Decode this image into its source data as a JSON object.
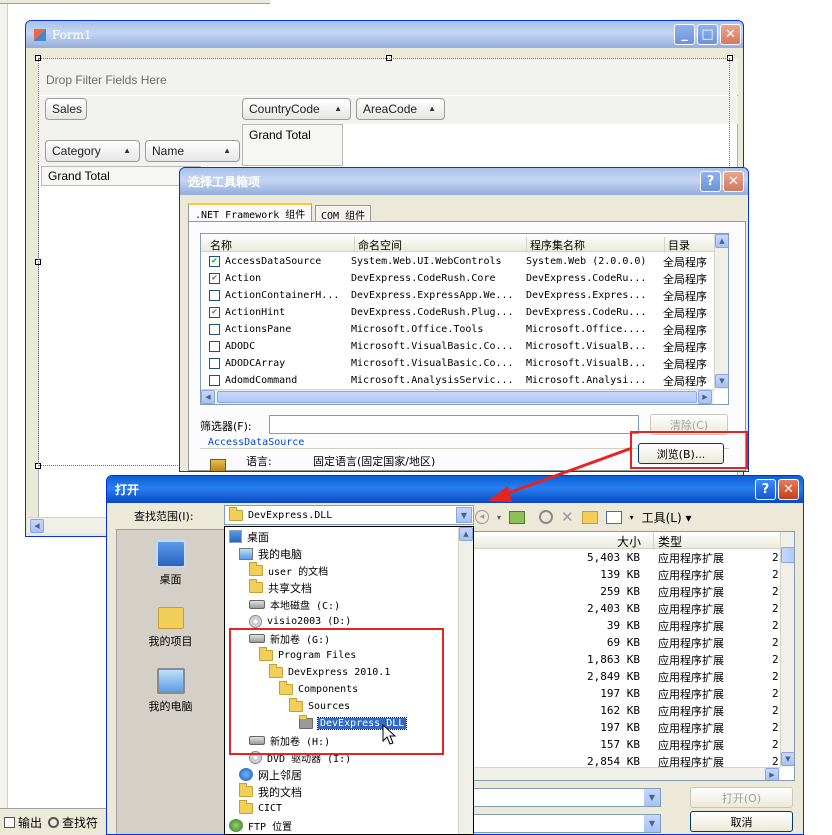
{
  "form1": {
    "title": "Form1",
    "drop_filter": "Drop Filter Fields Here",
    "fields": {
      "sales": "Sales",
      "countrycode": "CountryCode",
      "areacode": "AreaCode",
      "category": "Category",
      "name": "Name"
    },
    "grand_total_col": "Grand Total",
    "grand_total_row": "Grand Total"
  },
  "choose_dialog": {
    "title": "选择工具箱项",
    "tabs": [
      ".NET Framework 组件",
      "COM 组件"
    ],
    "columns": [
      "名称",
      "命名空间",
      "程序集名称",
      "目录"
    ],
    "rows": [
      {
        "checked": true,
        "name": "AccessDataSource",
        "ns": "System.Web.UI.WebControls",
        "asm": "System.Web (2.0.0.0)",
        "dir": "全局程序"
      },
      {
        "checked": true,
        "name": "Action",
        "ns": "DevExpress.CodeRush.Core",
        "asm": "DevExpress.CodeRu...",
        "dir": "全局程序"
      },
      {
        "checked": false,
        "name": "ActionContainerH...",
        "ns": "DevExpress.ExpressApp.We...",
        "asm": "DevExpress.Expres...",
        "dir": "全局程序"
      },
      {
        "checked": true,
        "name": "ActionHint",
        "ns": "DevExpress.CodeRush.Plug...",
        "asm": "DevExpress.CodeRu...",
        "dir": "全局程序"
      },
      {
        "checked": false,
        "name": "ActionsPane",
        "ns": "Microsoft.Office.Tools",
        "asm": "Microsoft.Office....",
        "dir": "全局程序"
      },
      {
        "checked": false,
        "name": "ADODC",
        "ns": "Microsoft.VisualBasic.Co...",
        "asm": "Microsoft.VisualB...",
        "dir": "全局程序"
      },
      {
        "checked": false,
        "name": "ADODCArray",
        "ns": "Microsoft.VisualBasic.Co...",
        "asm": "Microsoft.VisualB...",
        "dir": "全局程序"
      },
      {
        "checked": false,
        "name": "AdomdCommand",
        "ns": "Microsoft.AnalysisServic...",
        "asm": "Microsoft.Analysi...",
        "dir": "全局程序"
      }
    ],
    "filter_label": "筛选器(F):",
    "filter_value": "",
    "clear_button": "清除(C)",
    "selected_component": "AccessDataSource",
    "language_label": "语言:",
    "language_value": "固定语言(固定国家/地区)",
    "browse_button": "浏览(B)..."
  },
  "open_dialog": {
    "title": "打开",
    "lookin_label": "查找范围(I):",
    "lookin_value": "DevExpress.DLL",
    "tools_label": "工具(L)",
    "places": [
      {
        "label": "桌面",
        "icon": "desktop-icon"
      },
      {
        "label": "我的项目",
        "icon": "folder-icon"
      },
      {
        "label": "我的电脑",
        "icon": "computer-icon"
      }
    ],
    "tree": [
      {
        "label": "桌面",
        "type": "desktop",
        "indent": 0
      },
      {
        "label": "我的电脑",
        "type": "computer",
        "indent": 1
      },
      {
        "label": "user 的文档",
        "type": "folder",
        "indent": 2
      },
      {
        "label": "共享文档",
        "type": "folder",
        "indent": 2
      },
      {
        "label": "本地磁盘 (C:)",
        "type": "drive",
        "indent": 2
      },
      {
        "label": "visio2003 (D:)",
        "type": "cd",
        "indent": 2
      },
      {
        "label": "新加卷 (G:)",
        "type": "drive",
        "indent": 2
      },
      {
        "label": "Program Files",
        "type": "folder",
        "indent": 3
      },
      {
        "label": "DevExpress 2010.1",
        "type": "folder",
        "indent": 4
      },
      {
        "label": "Components",
        "type": "folder",
        "indent": 5
      },
      {
        "label": "Sources",
        "type": "folder",
        "indent": 6
      },
      {
        "label": "DevExpress.DLL",
        "type": "folder",
        "indent": 7,
        "selected": true
      },
      {
        "label": "新加卷 (H:)",
        "type": "drive",
        "indent": 2
      },
      {
        "label": "DVD 驱动器 (I:)",
        "type": "cd",
        "indent": 2
      },
      {
        "label": "网上邻居",
        "type": "network",
        "indent": 1
      },
      {
        "label": "我的文档",
        "type": "folder",
        "indent": 1
      },
      {
        "label": "CICT",
        "type": "folder",
        "indent": 1
      },
      {
        "label": "FTP 位置",
        "type": "ftp",
        "indent": 0
      }
    ],
    "columns": [
      "大小",
      "类型"
    ],
    "files": [
      {
        "size": "5,403 KB",
        "type": "应用程序扩展",
        "extra": "2"
      },
      {
        "size": "139 KB",
        "type": "应用程序扩展",
        "extra": "2"
      },
      {
        "size": "259 KB",
        "type": "应用程序扩展",
        "extra": "2"
      },
      {
        "size": "2,403 KB",
        "type": "应用程序扩展",
        "extra": "2"
      },
      {
        "size": "39 KB",
        "type": "应用程序扩展",
        "extra": "2"
      },
      {
        "size": "69 KB",
        "type": "应用程序扩展",
        "extra": "2"
      },
      {
        "size": "1,863 KB",
        "type": "应用程序扩展",
        "extra": "2"
      },
      {
        "size": "2,849 KB",
        "type": "应用程序扩展",
        "extra": "2"
      },
      {
        "size": "197 KB",
        "type": "应用程序扩展",
        "extra": "2"
      },
      {
        "size": "162 KB",
        "type": "应用程序扩展",
        "extra": "2"
      },
      {
        "size": "197 KB",
        "type": "应用程序扩展",
        "extra": "2"
      },
      {
        "size": "157 KB",
        "type": "应用程序扩展",
        "extra": "2"
      },
      {
        "size": "2,854 KB",
        "type": "应用程序扩展",
        "extra": "2"
      }
    ],
    "open_button": "打开(O)",
    "cancel_button": "取消"
  },
  "bottom_tabs": [
    "输出",
    "查找符"
  ]
}
